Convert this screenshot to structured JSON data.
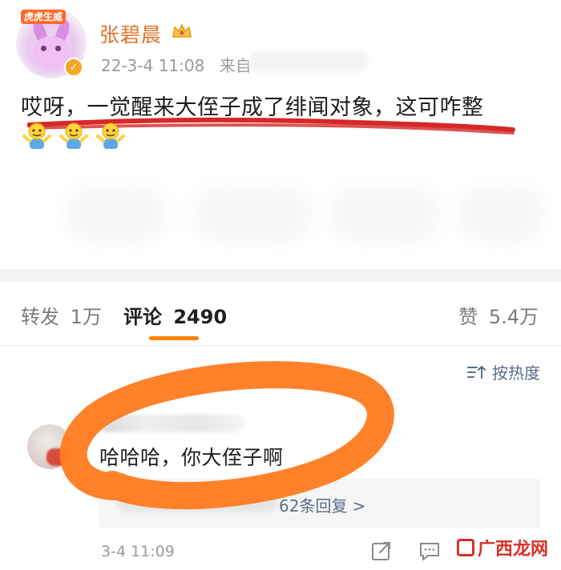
{
  "post": {
    "author": "张碧晨",
    "avatar_tag": "虎虎生威",
    "timestamp": "22-3-4 11:08",
    "source_prefix": "来自",
    "text": "哎呀，一觉醒来大侄子成了绯闻对象，这可咋整"
  },
  "tabs": {
    "repost_label": "转发",
    "repost_count": "1万",
    "comment_label": "评论",
    "comment_count": "2490",
    "like_label": "赞",
    "like_count": "5.4万"
  },
  "sort": {
    "label": "按热度"
  },
  "comment": {
    "text": "哈哈哈，你大侄子啊",
    "reply_link": "62条回复 >",
    "time": "3-4 11:09"
  },
  "watermark": {
    "text": "广西龙网"
  },
  "colors": {
    "accent": "#ff8200",
    "username": "#e0732a",
    "link": "#5a6c8a",
    "scribble": "#ff7a1f",
    "underline": "#d62828"
  },
  "icons": {
    "avatar_badge": "verified-badge-icon",
    "crown": "crown-icon",
    "sort": "sort-icon",
    "share": "share-icon",
    "reply": "comment-icon"
  }
}
